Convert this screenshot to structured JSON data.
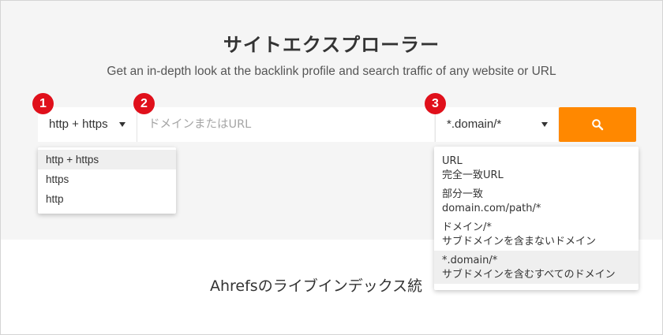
{
  "hero": {
    "title": "サイトエクスプローラー",
    "subtitle": "Get an in-depth look at the backlink profile and search traffic of any website or URL"
  },
  "search": {
    "protocol_selected": "http + https",
    "domain_placeholder": "ドメインまたはURL",
    "mode_selected": "*.domain/*",
    "search_icon": "search-icon"
  },
  "badges": [
    "1",
    "2",
    "3"
  ],
  "protocol_options": [
    {
      "label": "http + https",
      "active": true
    },
    {
      "label": "https",
      "active": false
    },
    {
      "label": "http",
      "active": false
    }
  ],
  "mode_options": [
    {
      "title": "URL",
      "desc": "完全一致URL"
    },
    {
      "title": "部分一致",
      "desc": "domain.com/path/*"
    },
    {
      "title": "ドメイン/*",
      "desc": "サブドメインを含まないドメイン"
    },
    {
      "title": "*.domain/*",
      "desc": "サブドメインを含むすべてのドメイン"
    }
  ],
  "footer": {
    "text": "Ahrefsのライブインデックス統"
  },
  "colors": {
    "accent": "#ff8800",
    "badge": "#e0101b",
    "hero_bg": "#f5f5f5"
  }
}
